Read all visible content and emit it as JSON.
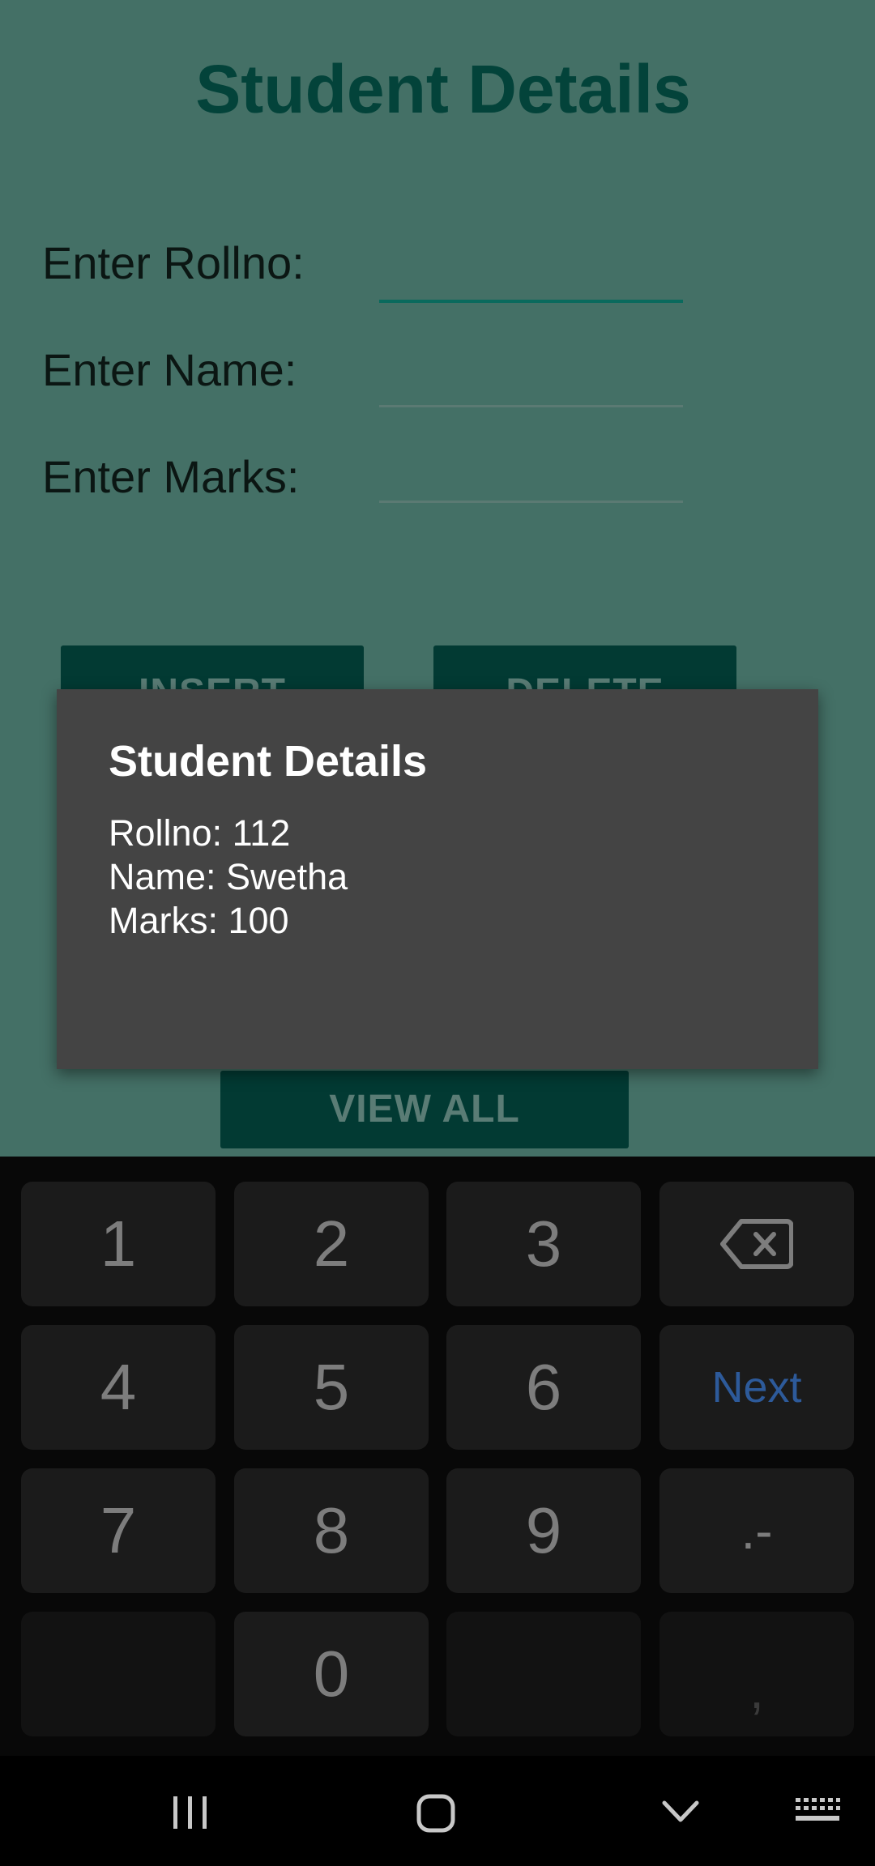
{
  "app": {
    "title": "Student Details",
    "fields": [
      {
        "label": "Enter Rollno:",
        "value": ""
      },
      {
        "label": "Enter Name:",
        "value": ""
      },
      {
        "label": "Enter Marks:",
        "value": ""
      }
    ],
    "buttons": {
      "insert": "INSERT",
      "delete": "DELETE",
      "view_all": "VIEW ALL"
    }
  },
  "dialog": {
    "title": "Student Details",
    "lines": [
      "Rollno: 112",
      "Name: Swetha",
      "Marks: 100"
    ]
  },
  "keyboard": {
    "keys": [
      "1",
      "2",
      "3",
      "4",
      "5",
      "6",
      "Next",
      "7",
      "8",
      "9",
      ".-",
      "0",
      ","
    ]
  },
  "colors": {
    "app_background": "#447066",
    "accent": "#03433a",
    "dialog": "#444444",
    "keyboard": "#080808",
    "next_key": "#2d5a9a"
  },
  "icons": {
    "backspace": "backspace-icon",
    "recents": "recents-icon",
    "home": "home-icon",
    "back": "back-chevron-icon",
    "keyboard": "keyboard-icon"
  }
}
